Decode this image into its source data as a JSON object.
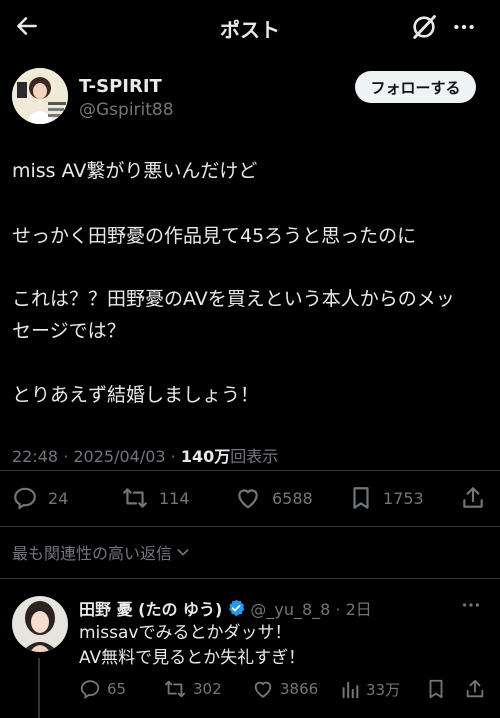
{
  "header": {
    "title": "ポスト"
  },
  "author": {
    "name": "T-SPIRIT",
    "handle": "@Gspirit88",
    "follow_label": "フォローする"
  },
  "post": {
    "lines": [
      "miss AV繋がり悪いんだけど",
      "せっかく田野憂の作品見て45ろうと思ったのに",
      "これは？？田野憂のAVを買えという本人からのメッ",
      "セージでは？",
      "とりあえず結婚しましょう！"
    ],
    "time": "22:48 · 2025/04/03 · ",
    "views_count": "140万",
    "views_label": "回表示"
  },
  "stats": {
    "replies": "24",
    "reposts": "114",
    "likes": "6588",
    "bookmarks": "1753"
  },
  "sort_label": "最も関連性の高い返信",
  "reply": {
    "name": "田野 憂 (たの ゆう)",
    "handle_time": "@_yu_8_8 · 2日",
    "lines": [
      "missavでみるとかダッサ！",
      "AV無料で見るとか失礼すぎ！"
    ],
    "replies": "65",
    "reposts": "302",
    "likes": "3866",
    "views": "33万"
  },
  "colors": {
    "background": "#000000",
    "text": "#e7e9ea",
    "muted": "#71767b",
    "verified": "#1d9bf0"
  }
}
